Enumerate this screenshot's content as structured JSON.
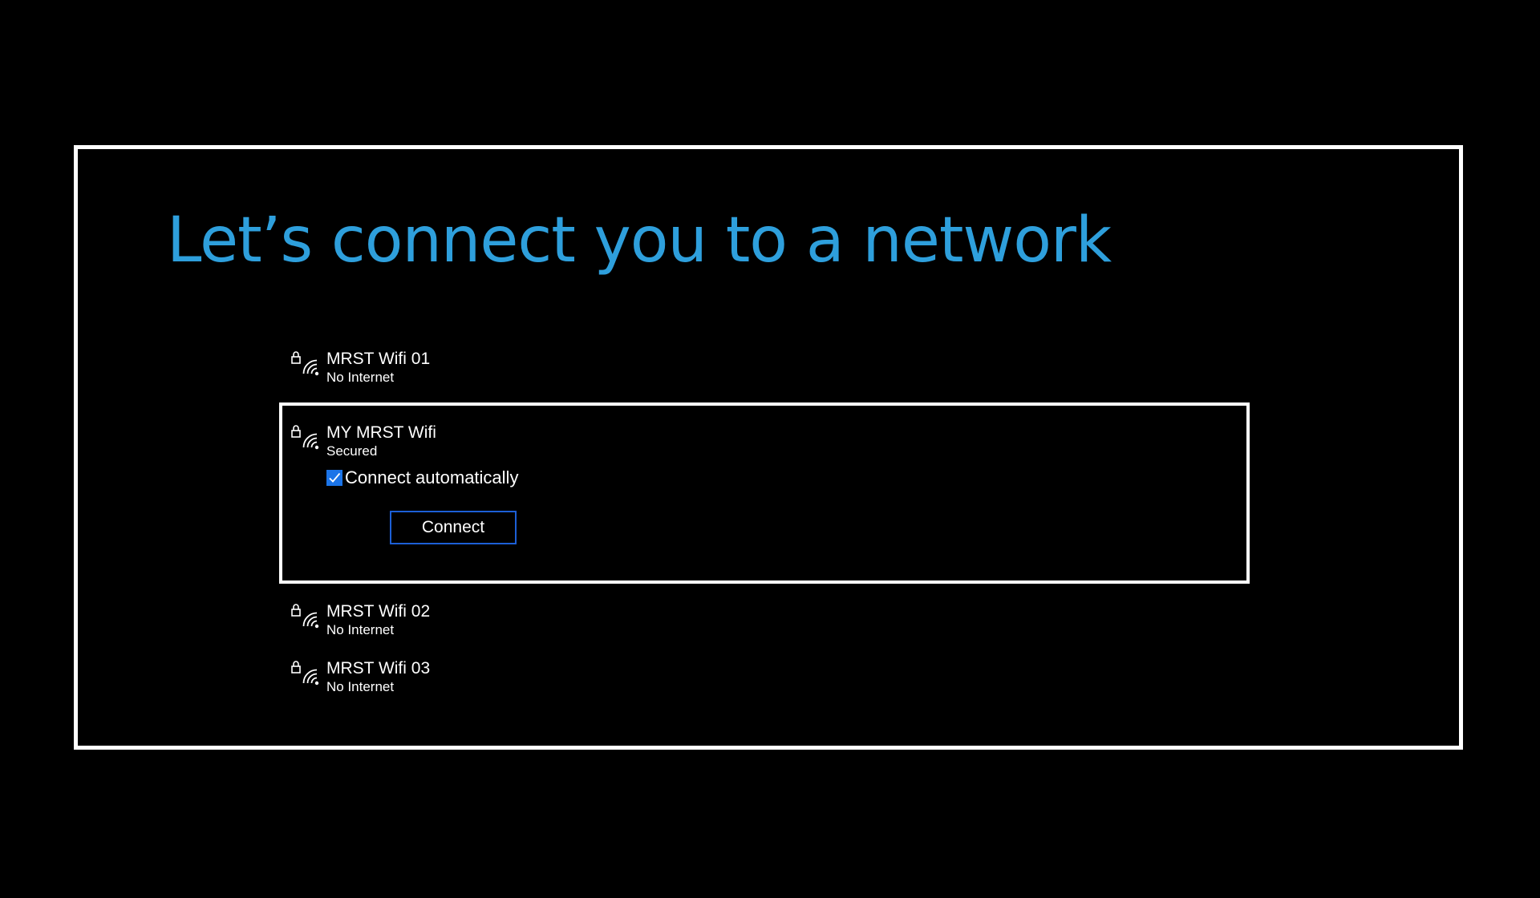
{
  "page": {
    "title": "Let’s connect you to a network"
  },
  "networks": [
    {
      "name": "MRST Wifi 01",
      "status": "No Internet",
      "secured_icon": "lock-icon",
      "signal_icon": "wifi-icon"
    },
    {
      "name": "MY MRST Wifi",
      "status": "Secured",
      "secured_icon": "lock-icon",
      "signal_icon": "wifi-icon",
      "selected": true
    },
    {
      "name": "MRST Wifi 02",
      "status": "No Internet",
      "secured_icon": "lock-icon",
      "signal_icon": "wifi-icon"
    },
    {
      "name": "MRST Wifi 03",
      "status": "No Internet",
      "secured_icon": "lock-icon",
      "signal_icon": "wifi-icon"
    }
  ],
  "selected_network": {
    "auto_connect_label": "Connect automatically",
    "auto_connect_checked": true,
    "connect_label": "Connect"
  },
  "colors": {
    "background": "#000000",
    "title": "#2e9fdc",
    "accent": "#1b74e8",
    "button_border": "#1c5fd6",
    "frame": "#ffffff"
  }
}
